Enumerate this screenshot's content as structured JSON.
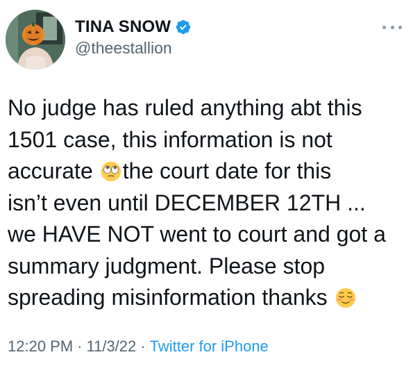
{
  "author": {
    "display_name": "TINA SNOW",
    "handle": "@theestallion",
    "verified": true,
    "avatar_icon": "avatar-pumpkin-mask-icon"
  },
  "tweet": {
    "lines": [
      {
        "before": "No judge has ruled anything abt this",
        "after": ""
      },
      {
        "before": "1501 case, this information is not",
        "after": ""
      },
      {
        "before": "accurate ",
        "emoji": "face-with-rolling-eyes",
        "after": "the court date for this"
      },
      {
        "before": "isn’t even until DECEMBER 12TH ...",
        "after": ""
      },
      {
        "before": "we HAVE NOT went to court and got a",
        "after": ""
      },
      {
        "before": "summary judgment. Please stop",
        "after": ""
      },
      {
        "before": "spreading misinformation thanks ",
        "emoji": "relieved-face",
        "after": ""
      }
    ]
  },
  "meta": {
    "time": "12:20 PM",
    "separator": "·",
    "date": "11/3/22",
    "source": "Twitter for iPhone"
  },
  "colors": {
    "verified": "#1d9bf0",
    "link": "#1d9bf0",
    "secondary_text": "#536471",
    "primary_text": "#0f1419"
  }
}
